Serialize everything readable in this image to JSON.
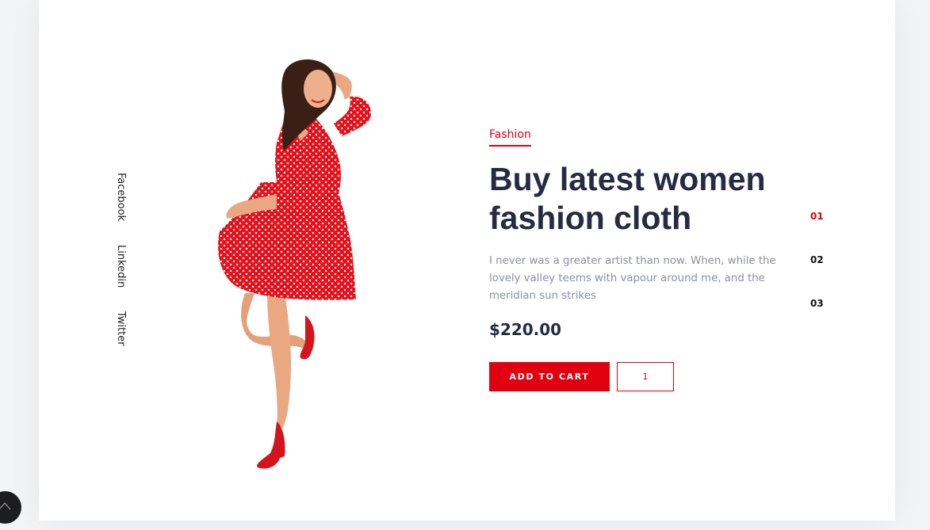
{
  "social": {
    "items": [
      {
        "label": "Facebook"
      },
      {
        "label": "Linkedin"
      },
      {
        "label": "Twitter"
      }
    ]
  },
  "product": {
    "category": "Fashion",
    "title": "Buy latest women fashion cloth",
    "description": "I never was a greater artist than now. When, while the lovely valley teems with vapour around me, and the meridian sun strikes",
    "price": "$220.00",
    "add_to_cart_label": "ADD TO CART",
    "quantity": "1"
  },
  "pager": {
    "items": [
      "01",
      "02",
      "03"
    ],
    "active_index": 0
  },
  "colors": {
    "accent": "#e1000f",
    "heading": "#252b42",
    "muted": "#8a8fa3"
  },
  "icons": {
    "scroll_top": "chevron-up-icon",
    "hero": "model-in-red-dress-image"
  }
}
